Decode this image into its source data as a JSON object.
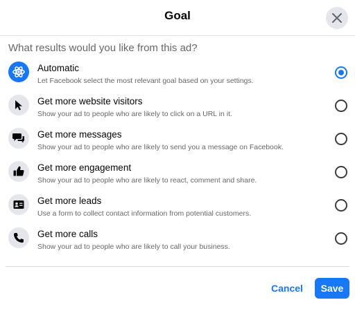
{
  "dialog": {
    "title": "Goal",
    "question": "What results would you like from this ad?",
    "close_icon": "close-icon"
  },
  "options": [
    {
      "title": "Automatic",
      "description": "Let Facebook select the most relevant goal based on your settings.",
      "icon": "atom-icon",
      "selected": true
    },
    {
      "title": "Get more website visitors",
      "description": "Show your ad to people who are likely to click on a URL in it.",
      "icon": "cursor-icon",
      "selected": false
    },
    {
      "title": "Get more messages",
      "description": "Show your ad to people who are likely to send you a message on Facebook.",
      "icon": "chat-icon",
      "selected": false
    },
    {
      "title": "Get more engagement",
      "description": "Show your ad to people who are likely to react, comment and share.",
      "icon": "thumbs-up-icon",
      "selected": false
    },
    {
      "title": "Get more leads",
      "description": "Use a form to collect contact information from potential customers.",
      "icon": "id-card-icon",
      "selected": false
    },
    {
      "title": "Get more calls",
      "description": "Show your ad to people who are likely to call your business.",
      "icon": "phone-icon",
      "selected": false
    }
  ],
  "footer": {
    "cancel_label": "Cancel",
    "save_label": "Save"
  },
  "colors": {
    "accent": "#1877f2",
    "icon_bg": "#e4e6eb",
    "secondary_text": "#65676b"
  }
}
